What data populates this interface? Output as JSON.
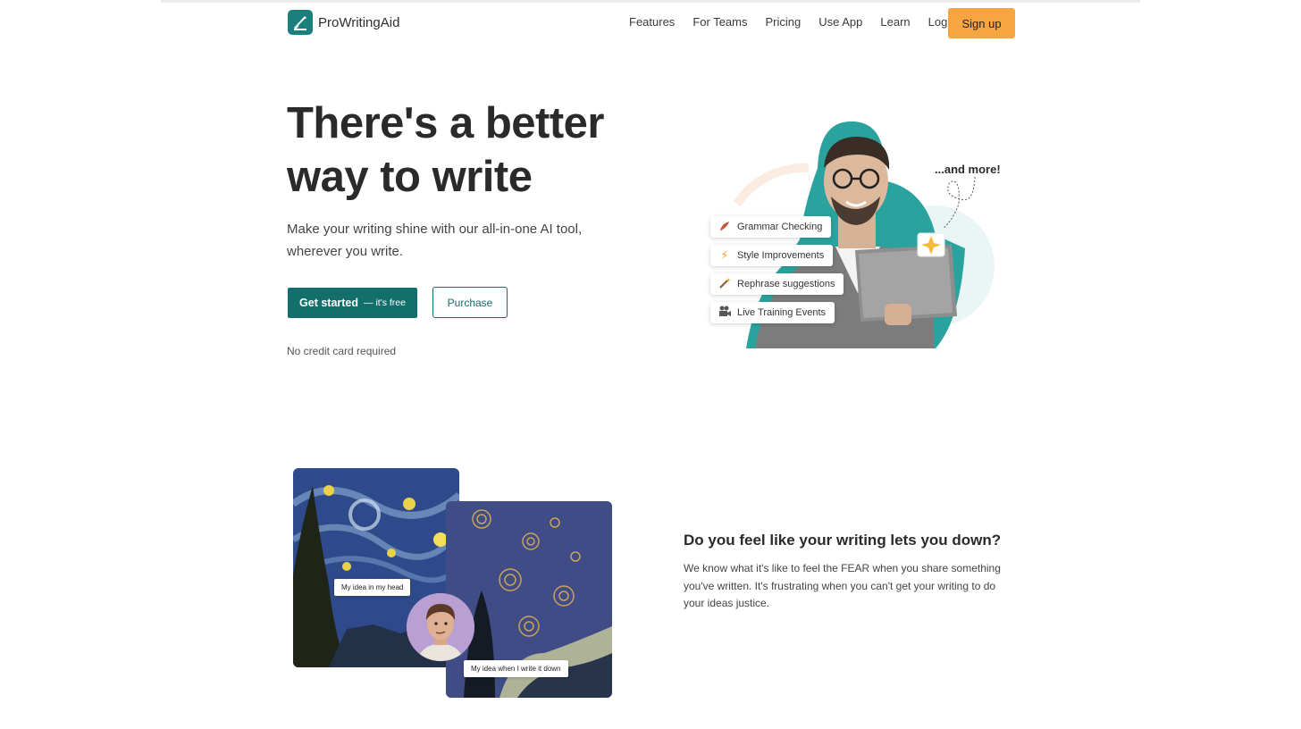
{
  "brand": {
    "name": "ProWritingAid",
    "logo_icon": "feather-logo-icon",
    "color": "#1a7f7d"
  },
  "nav": {
    "items": [
      {
        "label": "Features"
      },
      {
        "label": "For Teams"
      },
      {
        "label": "Pricing"
      },
      {
        "label": "Use App"
      },
      {
        "label": "Learn"
      },
      {
        "label": "Log in"
      }
    ],
    "signup_label": "Sign up",
    "signup_color": "#f7a540"
  },
  "hero": {
    "title": "There's a better way to write",
    "subtitle": "Make your writing shine with our all-in-one AI tool, wherever you write.",
    "primary_cta": "Get started",
    "primary_cta_suffix": "— it's free",
    "secondary_cta": "Purchase",
    "note": "No credit card required",
    "accent_color": "#136f6c"
  },
  "illustration": {
    "and_more": "...and more!",
    "features": [
      {
        "label": "Grammar Checking",
        "icon": "quill-icon"
      },
      {
        "label": "Style Improvements",
        "icon": "lightning-icon"
      },
      {
        "label": "Rephrase suggestions",
        "icon": "magic-wand-icon"
      },
      {
        "label": "Live Training Events",
        "icon": "video-camera-icon"
      }
    ]
  },
  "section2": {
    "title": "Do you feel like your writing lets you down?",
    "body": "We know what it's like to feel the FEAR when you share something you've written. It's frustrating when you can't get your writing to do your ideas justice.",
    "bubble_head": "My idea in my head",
    "bubble_written": "My idea when I write it down"
  }
}
